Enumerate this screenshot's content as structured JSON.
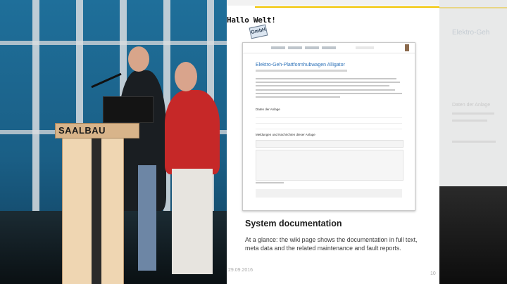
{
  "stage": {
    "lectern_brand": "SAALBAU",
    "date_stamp": "29.09.2016"
  },
  "slide": {
    "logo_text": "Hallo Welt!",
    "logo_badge": "GmbH",
    "screenshot_title": "Elektro-Geh-Plattformhubwagen Alligator",
    "section_1": "Daten der Anlage",
    "section_2": "Meldungen und Nachrichten dieser Anlage",
    "heading": "System documentation",
    "body": "At a glance: the wiki page shows the documentation in full text, meta data and the related maintenance and fault reports.",
    "date": "29.09.2016",
    "page_number": "10"
  },
  "next_slide": {
    "title": "Elektro-Geh",
    "subtitle": "Daten der Anlage"
  },
  "colors": {
    "accent": "#f1c400",
    "wiki_link": "#2e72b8",
    "stage_blue": "#1f6f9a"
  }
}
